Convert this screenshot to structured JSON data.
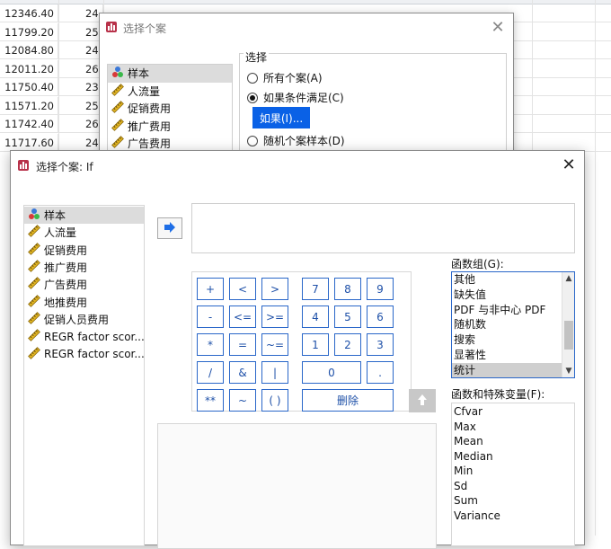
{
  "spreadsheet": {
    "rows": [
      {
        "c1": "12346.40",
        "c2": "24"
      },
      {
        "c1": "11799.20",
        "c2": "25"
      },
      {
        "c1": "12084.80",
        "c2": "24"
      },
      {
        "c1": "12011.20",
        "c2": "26"
      },
      {
        "c1": "11750.40",
        "c2": "23"
      },
      {
        "c1": "11571.20",
        "c2": "25"
      },
      {
        "c1": "11742.40",
        "c2": "26"
      },
      {
        "c1": "11717.60",
        "c2": "24"
      }
    ]
  },
  "dialog_select_cases": {
    "title": "选择个案",
    "variables": [
      "样本",
      "人流量",
      "促销费用",
      "推广费用",
      "广告费用"
    ],
    "select_group_label": "选择",
    "options": {
      "all_cases": "所有个案(A)",
      "if_condition": "如果条件满足(C)",
      "if_button": "如果(I)...",
      "random_sample": "随机个案样本(D)"
    }
  },
  "dialog_if": {
    "title": "选择个案: If",
    "variables": [
      "样本",
      "人流量",
      "促销费用",
      "推广费用",
      "广告费用",
      "地推费用",
      "促销人员费用",
      "REGR factor scor...",
      "REGR factor scor..."
    ],
    "expression": "",
    "keypad": {
      "plus": "+",
      "less": "<",
      "greater": ">",
      "k7": "7",
      "k8": "8",
      "k9": "9",
      "minus": "-",
      "less_equal": "<=",
      "greater_equal": ">=",
      "k4": "4",
      "k5": "5",
      "k6": "6",
      "multiply": "*",
      "equal": "=",
      "not_equal": "~=",
      "k1": "1",
      "k2": "2",
      "k3": "3",
      "divide": "/",
      "and": "&",
      "or": "|",
      "k0": "0",
      "dot": ".",
      "power": "**",
      "not": "~",
      "parens": "( )",
      "delete": "删除"
    },
    "function_group_label": "函数组(G):",
    "function_groups": [
      "其他",
      "缺失值",
      "PDF 与非中心 PDF",
      "随机数",
      "搜索",
      "显著性",
      "统计"
    ],
    "selected_function_group": "统计",
    "functions_label": "函数和特殊变量(F):",
    "functions": [
      "Cfvar",
      "Max",
      "Mean",
      "Median",
      "Min",
      "Sd",
      "Sum",
      "Variance"
    ]
  }
}
